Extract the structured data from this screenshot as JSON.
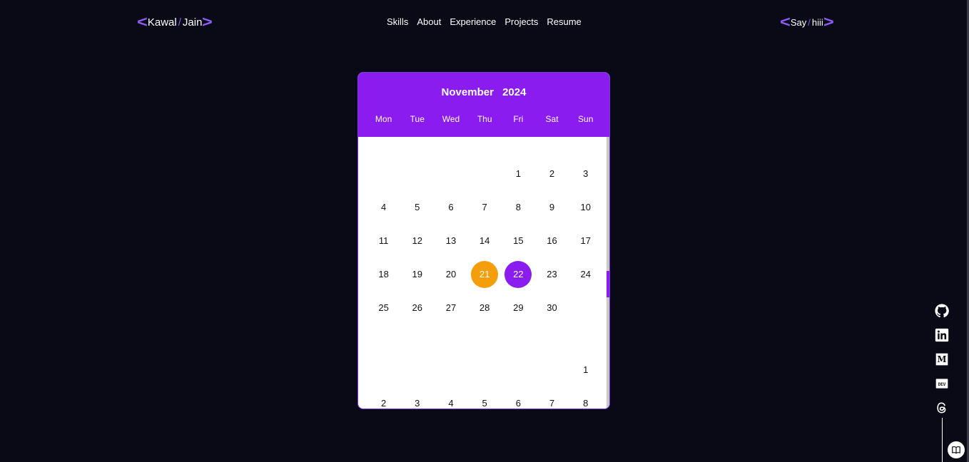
{
  "header": {
    "logo": {
      "first": "Kawal",
      "last": "Jain"
    },
    "nav": [
      "Skills",
      "About",
      "Experience",
      "Projects",
      "Resume"
    ],
    "cta": {
      "first": "Say",
      "last": "hiii"
    }
  },
  "calendar": {
    "month": "November",
    "year": "2024",
    "weekdays": [
      "Mon",
      "Tue",
      "Wed",
      "Thu",
      "Fri",
      "Sat",
      "Sun"
    ],
    "today": "21",
    "selected": "22",
    "november_days": [
      "",
      "",
      "",
      "",
      "1",
      "2",
      "3",
      "4",
      "5",
      "6",
      "7",
      "8",
      "9",
      "10",
      "11",
      "12",
      "13",
      "14",
      "15",
      "16",
      "17",
      "18",
      "19",
      "20",
      "21",
      "22",
      "23",
      "24",
      "25",
      "26",
      "27",
      "28",
      "29",
      "30",
      ""
    ],
    "december_days": [
      "",
      "",
      "",
      "",
      "",
      "",
      "1",
      "2",
      "3",
      "4",
      "5",
      "6",
      "7",
      "8"
    ]
  },
  "social": {
    "icons": [
      "github-icon",
      "linkedin-icon",
      "medium-icon",
      "dev-icon",
      "threads-icon"
    ],
    "guestbook_icon": "book-icon"
  },
  "colors": {
    "accent": "#8a1cf0",
    "today": "#f59e0b",
    "background": "#0a0916"
  }
}
